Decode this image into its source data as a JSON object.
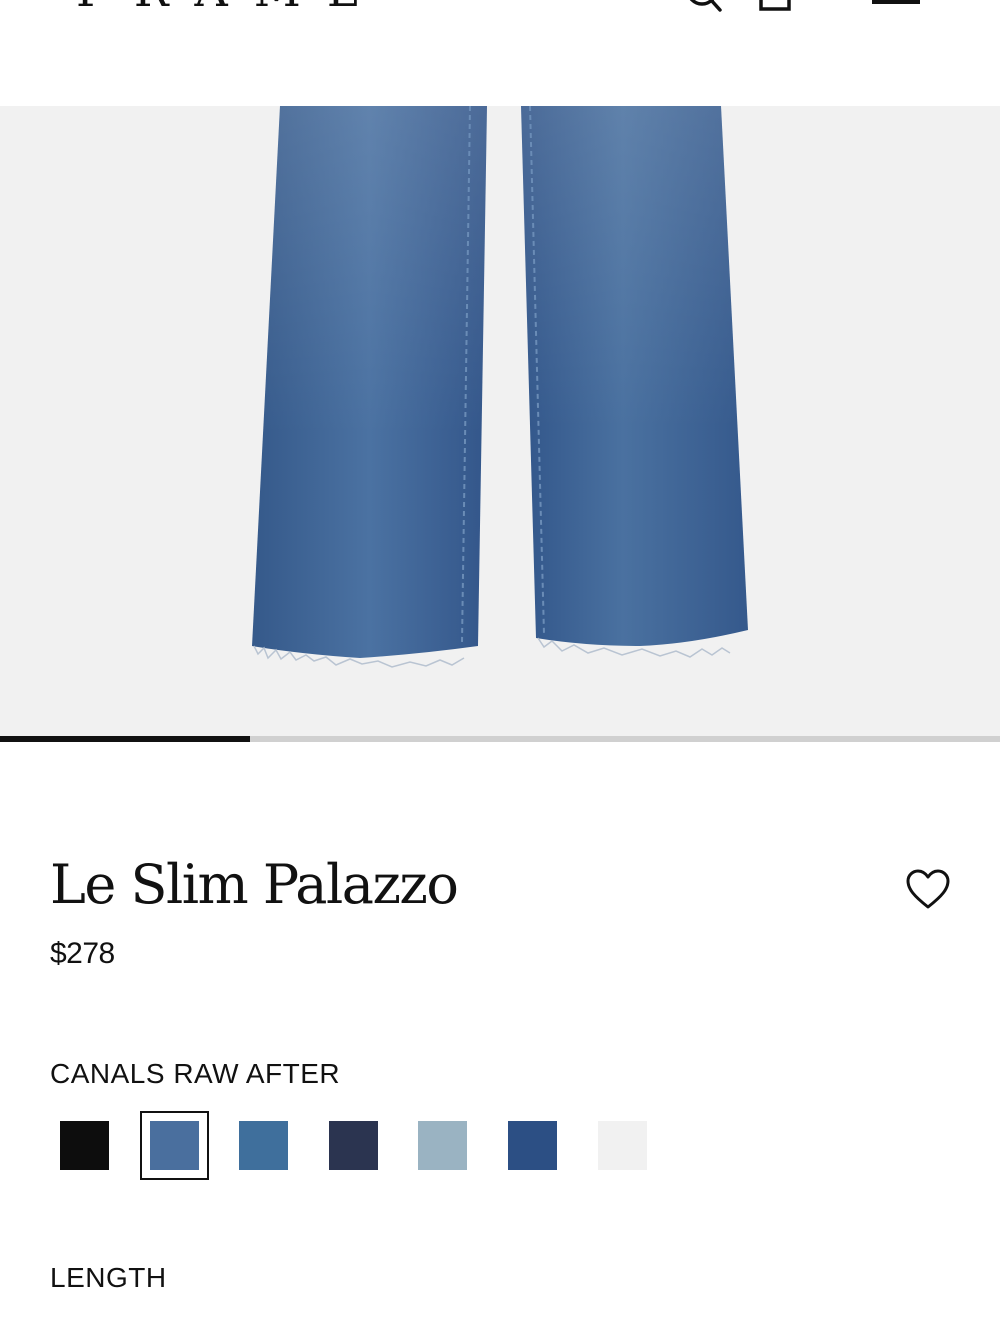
{
  "header": {
    "logo_text": "FRAME",
    "icons": [
      "search-icon",
      "shopping-bag-icon",
      "menu-icon"
    ]
  },
  "gallery": {
    "image": "product-photo-jeans",
    "image_index": 1,
    "image_count": 4
  },
  "product": {
    "name": "Le Slim Palazzo",
    "price": "$278",
    "wishlist_icon": "heart-icon",
    "color_name": "CANALS RAW AFTER",
    "swatches": [
      {
        "color": "#0d0d0d",
        "selected": false
      },
      {
        "color": "#4a6f9e",
        "selected": true
      },
      {
        "color": "#3f6f9c",
        "selected": false
      },
      {
        "color": "#2b3450",
        "selected": false
      },
      {
        "color": "#9ab3c2",
        "selected": false
      },
      {
        "color": "#2c4f84",
        "selected": false
      },
      {
        "color": "#f1f1f1",
        "selected": false
      }
    ],
    "length_label": "LENGTH"
  },
  "colors": {
    "text": "#111111",
    "gallery_bg": "#f1f1f1",
    "denim": "#3f6797"
  }
}
